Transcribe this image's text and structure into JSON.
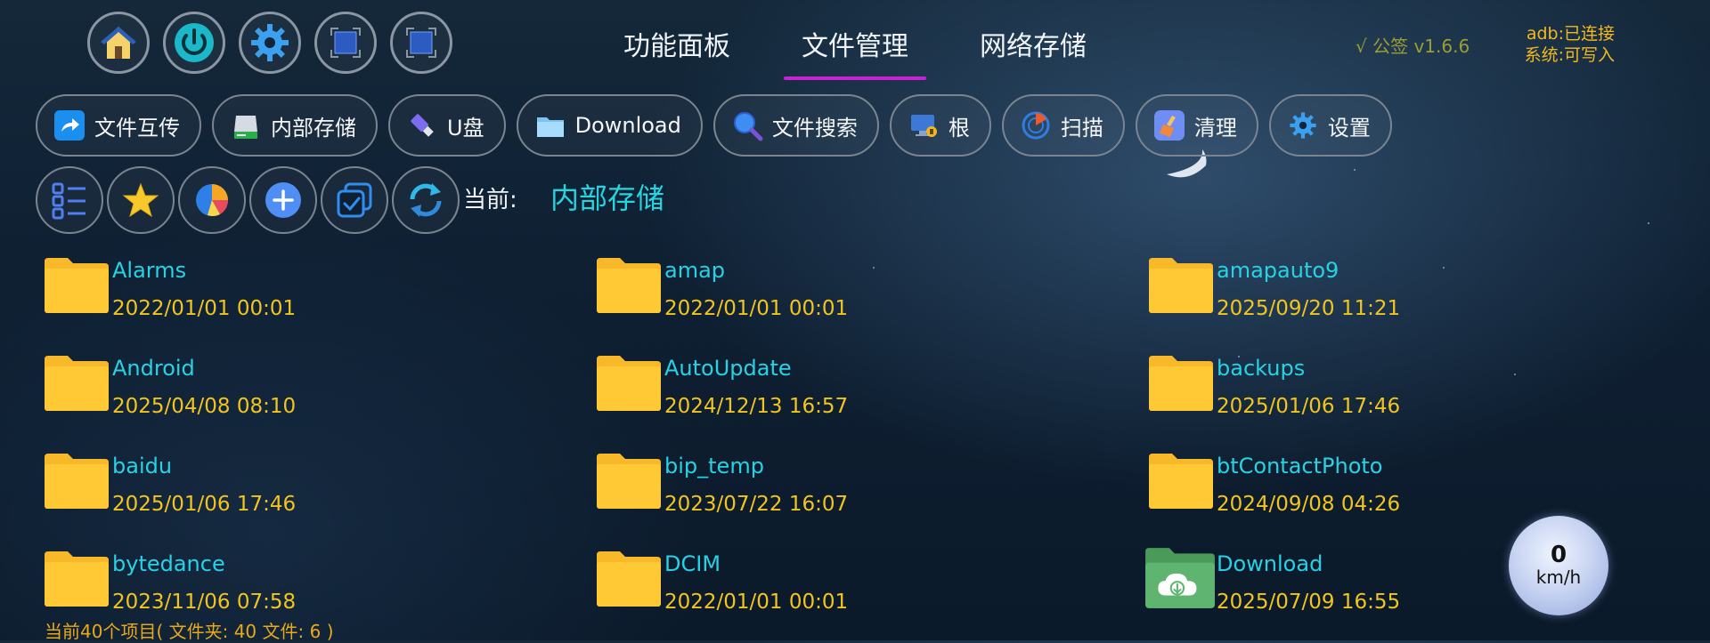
{
  "top_buttons": [
    {
      "name": "home-icon"
    },
    {
      "name": "power-icon"
    },
    {
      "name": "gear-icon"
    },
    {
      "name": "window-icon"
    },
    {
      "name": "window-icon-2"
    }
  ],
  "tabs": [
    {
      "label": "功能面板",
      "active": false
    },
    {
      "label": "文件管理",
      "active": true
    },
    {
      "label": "网络存储",
      "active": false
    }
  ],
  "version": "√ 公签 v1.6.6",
  "status": {
    "adb_label": "adb:",
    "adb_value": "已连接",
    "system_label": "系统:",
    "system_value": "可写入"
  },
  "pills": [
    {
      "label": "文件互传",
      "icon": "share-icon"
    },
    {
      "label": "内部存储",
      "icon": "drive-icon"
    },
    {
      "label": "U盘",
      "icon": "usb-icon"
    },
    {
      "label": "Download",
      "icon": "folder-icon"
    },
    {
      "label": "文件搜索",
      "icon": "search-icon"
    },
    {
      "label": "根",
      "icon": "root-icon"
    },
    {
      "label": "扫描",
      "icon": "scan-icon"
    },
    {
      "label": "清理",
      "icon": "clean-icon"
    },
    {
      "label": "设置",
      "icon": "settings-icon"
    }
  ],
  "tools": [
    "list-view-icon",
    "star-icon",
    "pie-chart-icon",
    "add-icon",
    "multi-select-icon",
    "refresh-icon"
  ],
  "current": {
    "label": "当前:",
    "path": "内部存储"
  },
  "files": [
    {
      "name": "Alarms",
      "date": "2022/01/01 00:01",
      "type": "folder"
    },
    {
      "name": "amap",
      "date": "2022/01/01 00:01",
      "type": "folder"
    },
    {
      "name": "amapauto9",
      "date": "2025/09/20 11:21",
      "type": "folder"
    },
    {
      "name": "Android",
      "date": "2025/04/08 08:10",
      "type": "folder"
    },
    {
      "name": "AutoUpdate",
      "date": "2024/12/13 16:57",
      "type": "folder"
    },
    {
      "name": "backups",
      "date": "2025/01/06 17:46",
      "type": "folder"
    },
    {
      "name": "baidu",
      "date": "2025/01/06 17:46",
      "type": "folder"
    },
    {
      "name": "bip_temp",
      "date": "2023/07/22 16:07",
      "type": "folder"
    },
    {
      "name": "btContactPhoto",
      "date": "2024/09/08 04:26",
      "type": "folder"
    },
    {
      "name": "bytedance",
      "date": "2023/11/06 07:58",
      "type": "folder"
    },
    {
      "name": "DCIM",
      "date": "2022/01/01 00:01",
      "type": "folder"
    },
    {
      "name": "Download",
      "date": "2025/07/09 16:55",
      "type": "download-folder"
    }
  ],
  "summary": "当前40个项目( 文件夹: 40   文件: 6 )",
  "speed": {
    "value": "0",
    "unit": "km/h"
  },
  "colors": {
    "accent_tab": "#c623d6",
    "file_name": "#27d2e4",
    "file_date": "#f2c41e",
    "folder": "#ffc935"
  }
}
